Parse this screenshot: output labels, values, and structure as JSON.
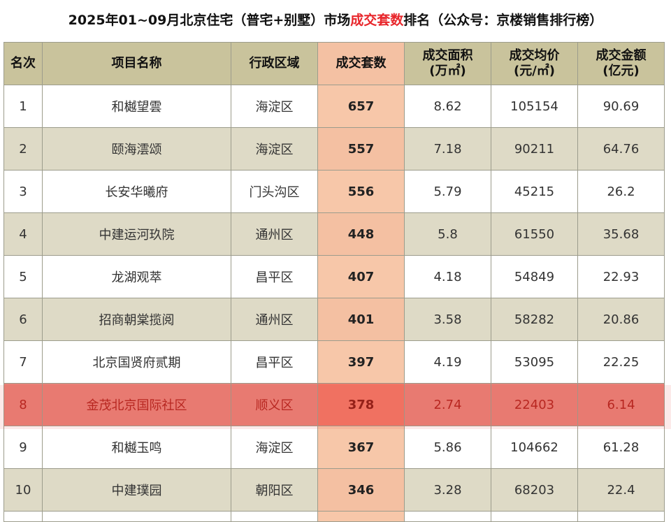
{
  "title": {
    "prefix": "2025年01~09月北京住宅（普宅+别墅）市场",
    "highlight": "成交套数",
    "suffix": "排名（公众号：京楼销售排行榜）"
  },
  "columns": [
    {
      "line1": "名次",
      "line2": ""
    },
    {
      "line1": "项目名称",
      "line2": ""
    },
    {
      "line1": "行政区域",
      "line2": ""
    },
    {
      "line1": "成交套数",
      "line2": ""
    },
    {
      "line1": "成交面积",
      "line2": "(万㎡)"
    },
    {
      "line1": "成交均价",
      "line2": "(元/㎡)"
    },
    {
      "line1": "成交金额",
      "line2": "(亿元)"
    }
  ],
  "rows": [
    {
      "rank": "1",
      "name": "和樾望雲",
      "district": "海淀区",
      "units": "657",
      "area": "8.62",
      "price": "105154",
      "amount": "90.69"
    },
    {
      "rank": "2",
      "name": "颐海澐颂",
      "district": "海淀区",
      "units": "557",
      "area": "7.18",
      "price": "90211",
      "amount": "64.76"
    },
    {
      "rank": "3",
      "name": "长安华曦府",
      "district": "门头沟区",
      "units": "556",
      "area": "5.79",
      "price": "45215",
      "amount": "26.2"
    },
    {
      "rank": "4",
      "name": "中建运河玖院",
      "district": "通州区",
      "units": "448",
      "area": "5.8",
      "price": "61550",
      "amount": "35.68"
    },
    {
      "rank": "5",
      "name": "龙湖观萃",
      "district": "昌平区",
      "units": "407",
      "area": "4.18",
      "price": "54849",
      "amount": "22.93"
    },
    {
      "rank": "6",
      "name": "招商朝棠揽阅",
      "district": "通州区",
      "units": "401",
      "area": "3.58",
      "price": "58282",
      "amount": "20.86"
    },
    {
      "rank": "7",
      "name": "北京国贤府贰期",
      "district": "昌平区",
      "units": "397",
      "area": "4.19",
      "price": "53095",
      "amount": "22.25"
    },
    {
      "rank": "8",
      "name": "金茂北京国际社区",
      "district": "顺义区",
      "units": "378",
      "area": "2.74",
      "price": "22403",
      "amount": "6.14"
    },
    {
      "rank": "9",
      "name": "和樾玉鸣",
      "district": "海淀区",
      "units": "367",
      "area": "5.86",
      "price": "104662",
      "amount": "61.28"
    },
    {
      "rank": "10",
      "name": "中建璞园",
      "district": "朝阳区",
      "units": "346",
      "area": "3.28",
      "price": "68203",
      "amount": "22.4"
    }
  ],
  "highlighted_rank": "8",
  "colors": {
    "header_bg": "#c9c39c",
    "stripe_bg": "#dedac6",
    "units_col_bg": "#f7c7a9",
    "highlight_row_bg": "#e98077",
    "title_highlight": "#e8262b"
  }
}
